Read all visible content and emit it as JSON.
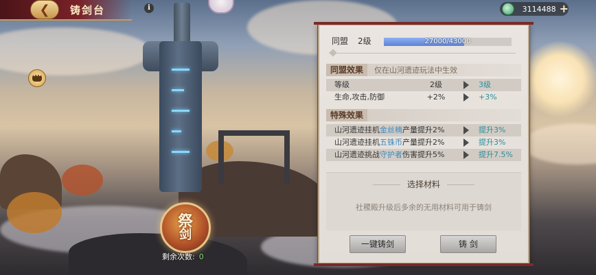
{
  "header": {
    "title": "铸剑台",
    "back_icon": "back-arrow-icon",
    "info_icon": "info-icon"
  },
  "currency": {
    "icon": "jade-coin-icon",
    "value": "3114488",
    "add_icon": "plus-icon"
  },
  "ritual": {
    "char1": "祭",
    "char2": "剑",
    "remaining_label": "剩余次数:",
    "remaining_value": "0"
  },
  "panel": {
    "league_label": "同盟",
    "league_level": "2级",
    "progress_text": "27000/43000",
    "progress_fraction": 0.628,
    "league_effect": {
      "title": "同盟效果",
      "note": "仅在山河遗迹玩法中生效",
      "rows": [
        {
          "name": "等级",
          "current": "2级",
          "next": "3级"
        },
        {
          "name": "生命,攻击,防御",
          "current": "+2%",
          "next": "+3%"
        }
      ]
    },
    "special_effect": {
      "title": "特殊效果",
      "rows": [
        {
          "prefix": "山河遗迹挂机",
          "item": "金丝楠",
          "suffix": "产量提升2%",
          "next": "提升3%"
        },
        {
          "prefix": "山河遗迹挂机",
          "item": "五铢币",
          "suffix": "产量提升2%",
          "next": "提升3%"
        },
        {
          "prefix": "山河遗迹挑战",
          "item": "守护者",
          "suffix": "伤害提升5%",
          "next": "提升7.5%"
        }
      ]
    },
    "materials": {
      "title": "选择材料",
      "hint": "社稷殿升级后多余的无用材料可用于铸剑"
    },
    "buttons": {
      "one_click": "一键铸剑",
      "forge": "铸 剑"
    }
  },
  "colors": {
    "accent_red": "#7b2a26",
    "gold": "#c89a56",
    "progress_blue": "#5b82d6",
    "next_value": "#2b8f9b",
    "highlight_item": "#3d8bbf"
  }
}
